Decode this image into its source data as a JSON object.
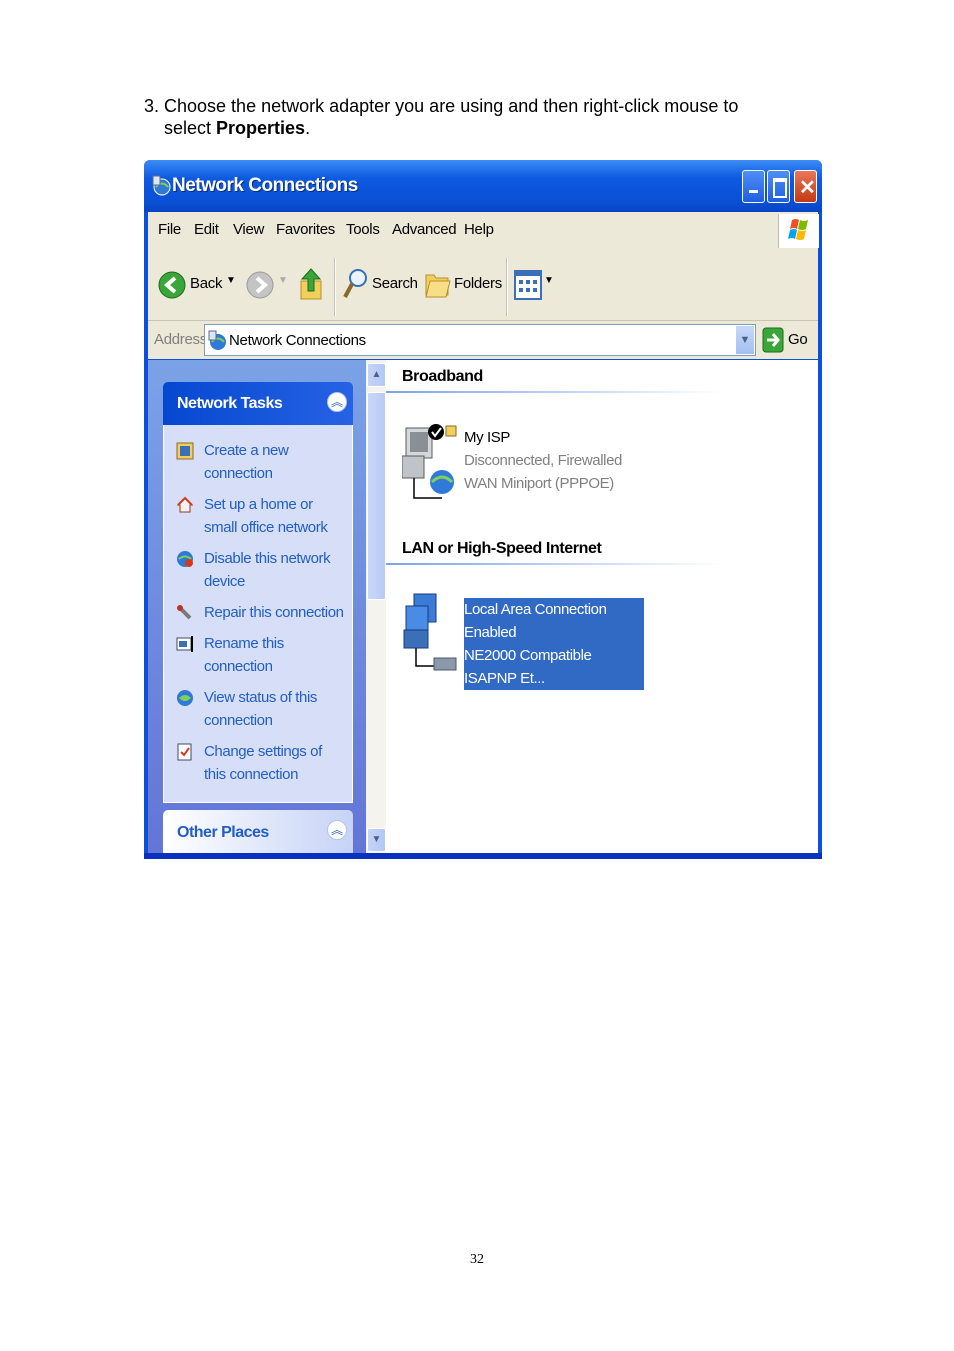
{
  "instruction": {
    "line1": "3. Choose the network adapter you are using and then right-click mouse to",
    "line2_prefix": "select ",
    "line2_bold": "Properties",
    "line2_suffix": "."
  },
  "window": {
    "title": "Network Connections",
    "menu": [
      "File",
      "Edit",
      "View",
      "Favorites",
      "Tools",
      "Advanced",
      "Help"
    ],
    "toolbar": {
      "back_label": "Back",
      "search_label": "Search",
      "folders_label": "Folders"
    },
    "address": {
      "label": "Address",
      "value": "Network Connections",
      "go_label": "Go"
    }
  },
  "left_pane": {
    "network_tasks": {
      "title": "Network Tasks",
      "tasks": [
        "Create a new connection",
        "Set up a home or small office network",
        "Disable this network device",
        "Repair this connection",
        "Rename this connection",
        "View status of this connection",
        "Change settings of this connection"
      ]
    },
    "other_places": {
      "title": "Other Places"
    }
  },
  "main": {
    "groups": [
      {
        "title": "Broadband",
        "connections": [
          {
            "name": "My ISP",
            "status": "Disconnected, Firewalled",
            "device": "WAN Miniport (PPPOE)"
          }
        ]
      },
      {
        "title": "LAN or High-Speed Internet",
        "connections": [
          {
            "name": "Local Area Connection",
            "status": "Enabled",
            "device": "NE2000 Compatible ISAPNP Et..."
          }
        ]
      }
    ]
  },
  "page_number": "32",
  "colors": {
    "titlebar": "#0a50d8",
    "task_link": "#215dc6",
    "selection": "#316ac5",
    "left_pane": "#7ba2e7"
  }
}
